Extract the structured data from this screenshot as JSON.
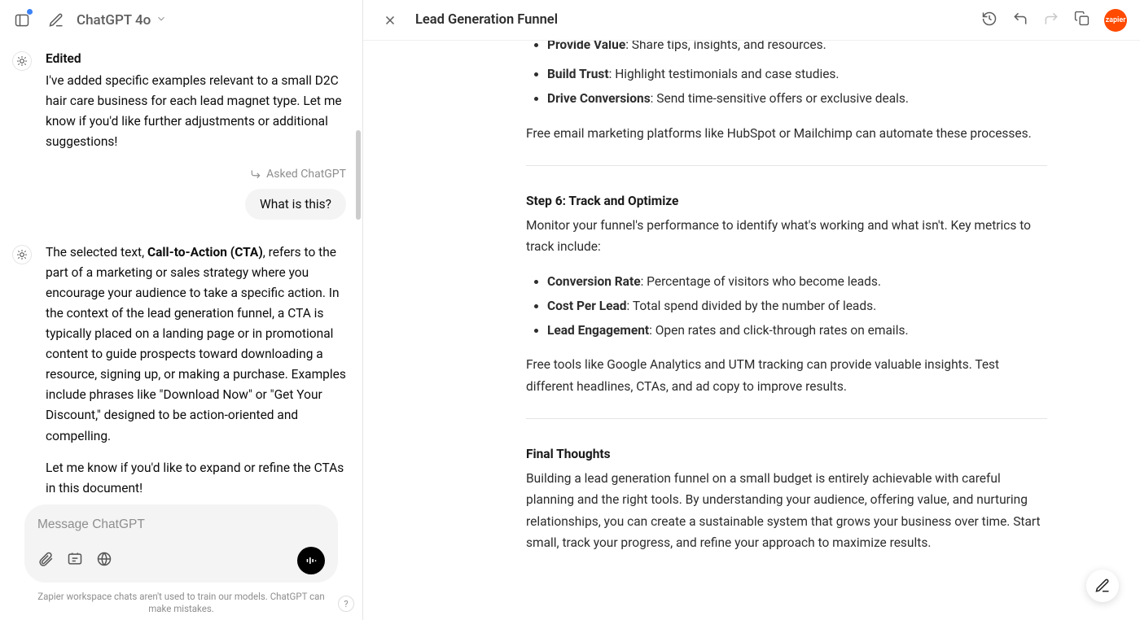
{
  "header": {
    "model": "ChatGPT 4o"
  },
  "chat": {
    "edited_label": "Edited",
    "first_assistant": "I've added specific examples relevant to a small D2C hair care business for each lead magnet type. Let me know if you'd like further adjustments or additional suggestions!",
    "asked_label": "Asked ChatGPT",
    "user_question": "What is this?",
    "cta_intro": "The selected text, ",
    "cta_bold": "Call-to-Action (CTA)",
    "cta_body": ", refers to the part of a marketing or sales strategy where you encourage your audience to take a specific action. In the context of the lead generation funnel, a CTA is typically placed on a landing page or in promotional content to guide prospects toward downloading a resource, signing up, or making a purchase. Examples include phrases like \"Download Now\" or \"Get Your Discount,\" designed to be action-oriented and compelling.",
    "cta_followup": "Let me know if you'd like to expand or refine the CTAs in this document!"
  },
  "composer": {
    "placeholder": "Message ChatGPT"
  },
  "footer": {
    "disclaimer": "Zapier workspace chats aren't used to train our models. ChatGPT can make mistakes.",
    "help": "?"
  },
  "doc": {
    "title": "Lead Generation Funnel",
    "brand": "zapier",
    "cut_bullet_bold": "Provide Value",
    "cut_bullet_rest": ": Share tips, insights, and resources.",
    "bullets1": [
      {
        "bold": "Build Trust",
        "rest": ": Highlight testimonials and case studies."
      },
      {
        "bold": "Drive Conversions",
        "rest": ": Send time-sensitive offers or exclusive deals."
      }
    ],
    "p1": "Free email marketing platforms like HubSpot or Mailchimp can automate these processes.",
    "h2": "Step 6: Track and Optimize",
    "p2": "Monitor your funnel's performance to identify what's working and what isn't. Key metrics to track include:",
    "bullets2": [
      {
        "bold": "Conversion Rate",
        "rest": ": Percentage of visitors who become leads."
      },
      {
        "bold": "Cost Per Lead",
        "rest": ": Total spend divided by the number of leads."
      },
      {
        "bold": "Lead Engagement",
        "rest": ": Open rates and click-through rates on emails."
      }
    ],
    "p3": "Free tools like Google Analytics and UTM tracking can provide valuable insights. Test different headlines, CTAs, and ad copy to improve results.",
    "h3": "Final Thoughts",
    "p4": "Building a lead generation funnel on a small budget is entirely achievable with careful planning and the right tools. By understanding your audience, offering value, and nurturing relationships, you can create a sustainable system that grows your business over time. Start small, track your progress, and refine your approach to maximize results."
  }
}
